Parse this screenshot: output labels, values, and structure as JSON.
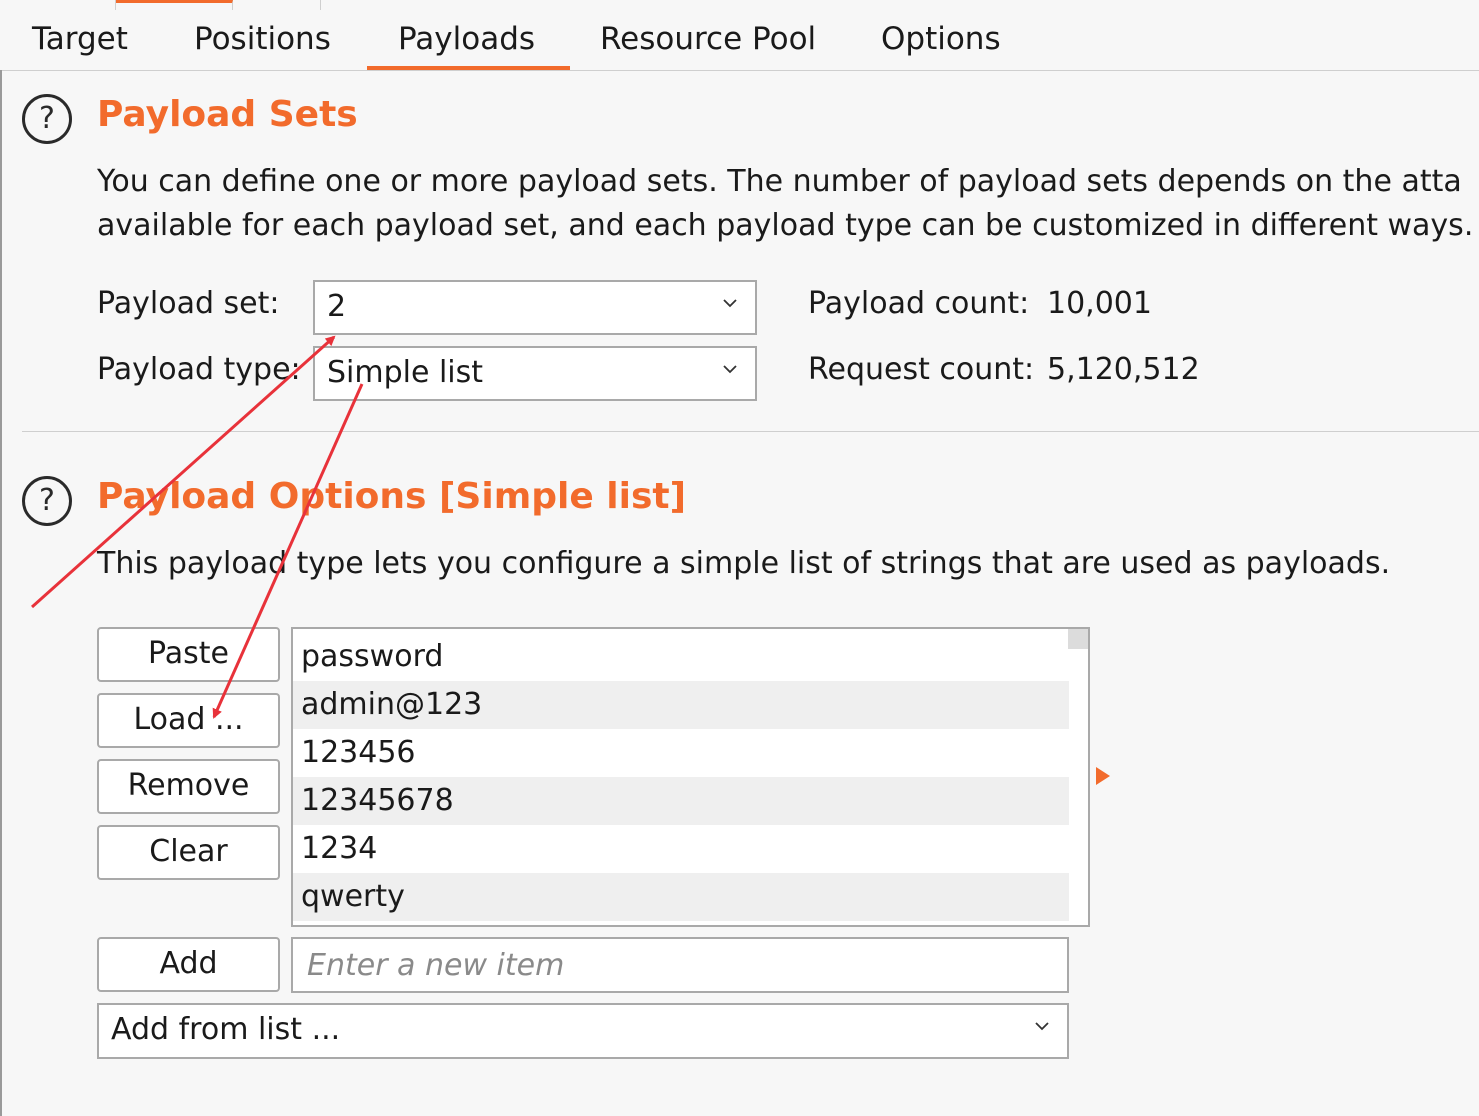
{
  "tabs": [
    {
      "label": "Target"
    },
    {
      "label": "Positions"
    },
    {
      "label": "Payloads"
    },
    {
      "label": "Resource Pool"
    },
    {
      "label": "Options"
    }
  ],
  "active_tab": "Payloads",
  "help_icon_glyph": "?",
  "payload_sets": {
    "title": "Payload Sets",
    "description_line1": "You can define one or more payload sets. The number of payload sets depends on the atta",
    "description_line2": "available for each payload set, and each payload type can be customized in different ways.",
    "payload_set_label": "Payload set:",
    "payload_set_value": "2",
    "payload_type_label": "Payload type:",
    "payload_type_value": "Simple list",
    "payload_count_label": "Payload count:",
    "payload_count_value": "10,001",
    "request_count_label": "Request count:",
    "request_count_value": "5,120,512"
  },
  "payload_options": {
    "title": "Payload Options [Simple list]",
    "description": "This payload type lets you configure a simple list of strings that are used as payloads.",
    "buttons": {
      "paste": "Paste",
      "load": "Load ...",
      "remove": "Remove",
      "clear": "Clear",
      "add": "Add"
    },
    "items": [
      "password",
      "admin@123",
      "123456",
      "12345678",
      "1234",
      "qwerty"
    ],
    "new_item_placeholder": "Enter a new item",
    "add_from_list": "Add from list ..."
  },
  "colors": {
    "accent": "#f26b2c",
    "annotation_arrow": "#e8323a"
  },
  "icons": [
    "help-icon",
    "chevron-down-icon",
    "expand-triangle-icon"
  ]
}
